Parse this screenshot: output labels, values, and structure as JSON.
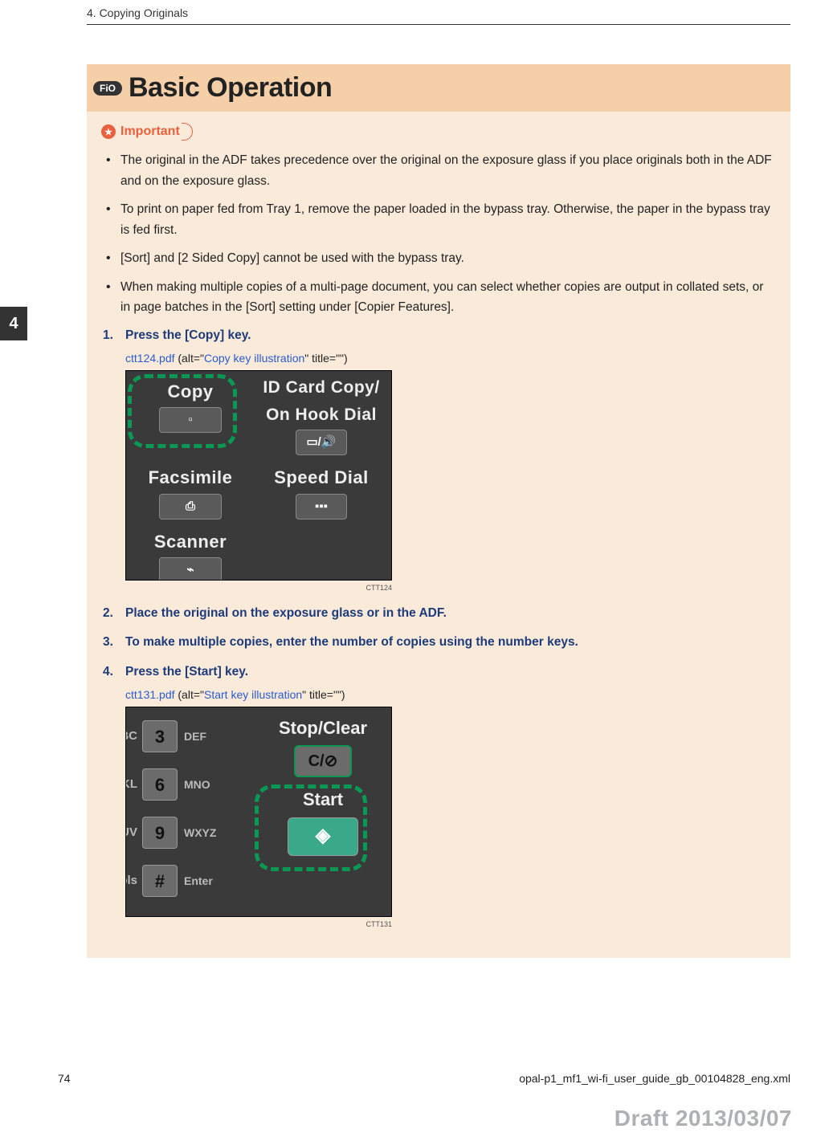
{
  "chapter_header": "4. Copying Originals",
  "side_tab": "4",
  "fio_label": "FiO",
  "page_title": "Basic Operation",
  "important_label": "Important",
  "bullets": [
    "The original in the ADF takes precedence over the original on the exposure glass if you place originals both in the ADF and on the exposure glass.",
    "To print on paper fed from Tray 1, remove the paper loaded in the bypass tray. Otherwise, the paper in the bypass tray is fed first.",
    "[Sort] and [2 Sided Copy] cannot be used with the bypass tray.",
    "When making multiple copies of a multi-page document, you can select whether copies are output in collated sets, or in page batches in the [Sort] setting under [Copier Features]."
  ],
  "steps": {
    "s1": "Press the [Copy] key.",
    "s2": "Place the original on the exposure glass or in the ADF.",
    "s3": "To make multiple copies, enter the number of copies using the number keys.",
    "s4": "Press the [Start] key."
  },
  "fig1": {
    "file": "ctt124.pdf",
    "alt_prefix": " (alt=\"",
    "alt_text": "Copy key illustration",
    "alt_suffix": "\" title=\"\")",
    "caption": "CTT124",
    "labels": {
      "copy": "Copy",
      "idcard1": "ID Card Copy/",
      "idcard2": "On Hook Dial",
      "facsimile": "Facsimile",
      "speed": "Speed Dial",
      "scanner": "Scanner"
    }
  },
  "fig2": {
    "file": "ctt131.pdf",
    "alt_prefix": " (alt=\"",
    "alt_text": "Start key illustration",
    "alt_suffix": "\" title=\"\")",
    "caption": "CTT131",
    "numpad": {
      "r1l": "ABC",
      "r1n": "3",
      "r1r": "DEF",
      "r2l": "JKL",
      "r2n": "6",
      "r2r": "MNO",
      "r3l": "TUV",
      "r3n": "9",
      "r3r": "WXYZ",
      "r4l": "mbols",
      "r4n": "#",
      "r4r": "Enter"
    },
    "labels": {
      "stopclear": "Stop/Clear",
      "stopbtn": "C/⊘",
      "start": "Start"
    }
  },
  "footer": {
    "page": "74",
    "file": "opal-p1_mf1_wi-fi_user_guide_gb_00104828_eng.xml"
  },
  "draft": "Draft 2013/03/07"
}
